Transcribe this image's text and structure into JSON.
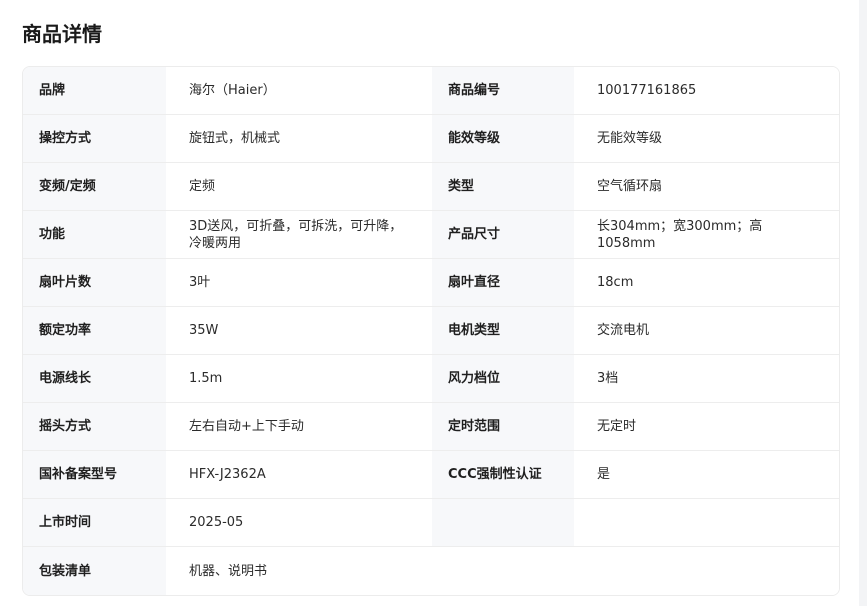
{
  "section": {
    "title": "商品详情"
  },
  "specs": {
    "rows": [
      {
        "left_label": "品牌",
        "left_value": "海尔（Haier）",
        "right_label": "商品编号",
        "right_value": "100177161865"
      },
      {
        "left_label": "操控方式",
        "left_value": "旋钮式，机械式",
        "right_label": "能效等级",
        "right_value": "无能效等级"
      },
      {
        "left_label": "变频/定频",
        "left_value": "定频",
        "right_label": "类型",
        "right_value": "空气循环扇"
      },
      {
        "left_label": "功能",
        "left_value": "3D送风，可折叠，可拆洗，可升降，冷暖两用",
        "right_label": "产品尺寸",
        "right_value": "长304mm；宽300mm；高1058mm"
      },
      {
        "left_label": "扇叶片数",
        "left_value": "3叶",
        "right_label": "扇叶直径",
        "right_value": "18cm"
      },
      {
        "left_label": "额定功率",
        "left_value": "35W",
        "right_label": "电机类型",
        "right_value": "交流电机"
      },
      {
        "left_label": "电源线长",
        "left_value": "1.5m",
        "right_label": "风力档位",
        "right_value": "3档"
      },
      {
        "left_label": "摇头方式",
        "left_value": "左右自动+上下手动",
        "right_label": "定时范围",
        "right_value": "无定时"
      },
      {
        "left_label": "国补备案型号",
        "left_value": "HFX-J2362A",
        "right_label": "CCC强制性认证",
        "right_value": "是"
      },
      {
        "left_label": "上市时间",
        "left_value": "2025-05",
        "right_label": "",
        "right_value": ""
      }
    ],
    "last_row": {
      "label": "包装清单",
      "value": "机器、说明书"
    }
  }
}
